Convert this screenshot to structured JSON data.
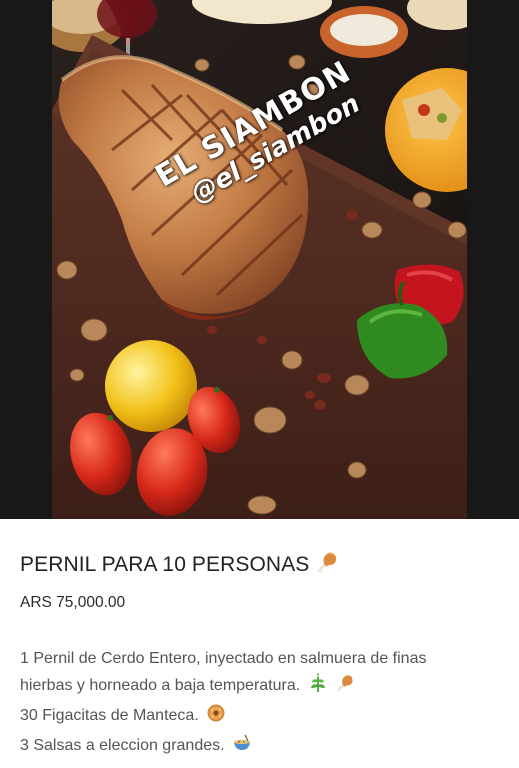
{
  "product": {
    "image": {
      "watermark_brand": "EL SIAMBON",
      "watermark_handle": "@el_siambon"
    },
    "title": "PERNIL PARA 10 PERSONAS",
    "title_emoji": "drumstick-icon",
    "price": "ARS 75,000.00",
    "description": [
      {
        "text": "1 Pernil de Cerdo Entero, inyectado en salmuera de finas",
        "emojis": []
      },
      {
        "text": "hierbas y horneado a baja temperatura.",
        "emojis": [
          "herb-icon",
          "drumstick-icon"
        ]
      },
      {
        "text": "30 Figacitas de Manteca.",
        "emojis": [
          "bagel-icon"
        ]
      },
      {
        "text": "3 Salsas a eleccion grandes.",
        "emojis": [
          "bowl-icon"
        ]
      }
    ]
  },
  "colors": {
    "text_primary": "#222222",
    "text_secondary": "#555555",
    "background": "#ffffff",
    "photo_backdrop": "#181818"
  }
}
